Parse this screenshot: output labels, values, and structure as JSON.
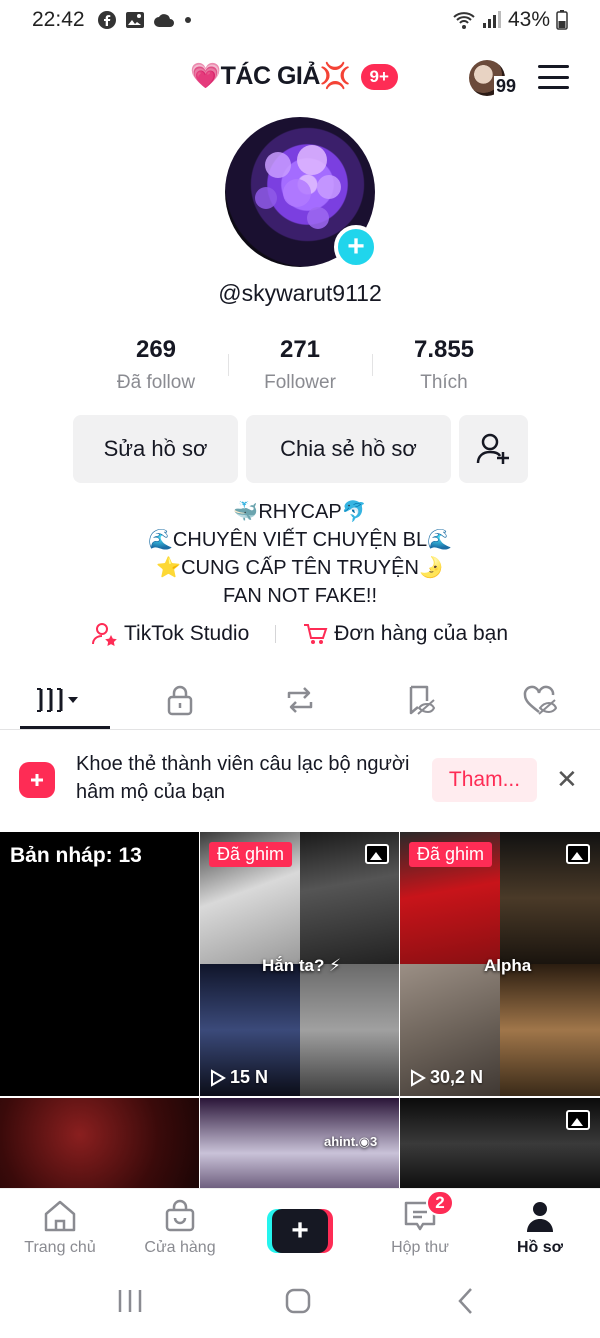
{
  "status_bar": {
    "time": "22:42",
    "battery": "43%"
  },
  "header": {
    "title": "💗TÁC GIẢ💢",
    "notif_count": "9+",
    "avatar_count": "99"
  },
  "profile": {
    "username": "@skywarut9112",
    "stats": [
      {
        "value": "269",
        "label": "Đã follow"
      },
      {
        "value": "271",
        "label": "Follower"
      },
      {
        "value": "7.855",
        "label": "Thích"
      }
    ],
    "edit_label": "Sửa hồ sơ",
    "share_label": "Chia sẻ hồ sơ",
    "bio": [
      "🐳RHYCAP🐬",
      "🌊CHUYÊN VIẾT CHUYỆN BL🌊",
      "⭐CUNG CẤP TÊN TRUYỆN🌛",
      "FAN NOT FAKE!!"
    ],
    "studio_label": "TikTok Studio",
    "orders_label": "Đơn hàng của bạn"
  },
  "banner": {
    "text": "Khoe thẻ thành viên câu lạc bộ người hâm mộ của bạn",
    "button": "Tham..."
  },
  "grid": {
    "drafts_label": "Bản nháp: 13",
    "pinned_label": "Đã ghim",
    "videos": [
      {
        "caption": "Hắn ta? ⚡",
        "views": "15 N"
      },
      {
        "caption": "Alpha",
        "views": "30,2 N"
      }
    ],
    "row2_caption": "ahint.◉3"
  },
  "bottom_nav": {
    "items": [
      {
        "label": "Trang chủ",
        "icon": "home-icon"
      },
      {
        "label": "Cửa hàng",
        "icon": "shop-icon"
      },
      {
        "label": "Hộp thư",
        "icon": "inbox-icon"
      },
      {
        "label": "Hồ sơ",
        "icon": "profile-icon"
      }
    ],
    "inbox_badge": "2"
  },
  "colors": {
    "accent": "#fe2c55",
    "cyan": "#20d5ec",
    "text": "#161823",
    "muted": "#8a8b91"
  }
}
